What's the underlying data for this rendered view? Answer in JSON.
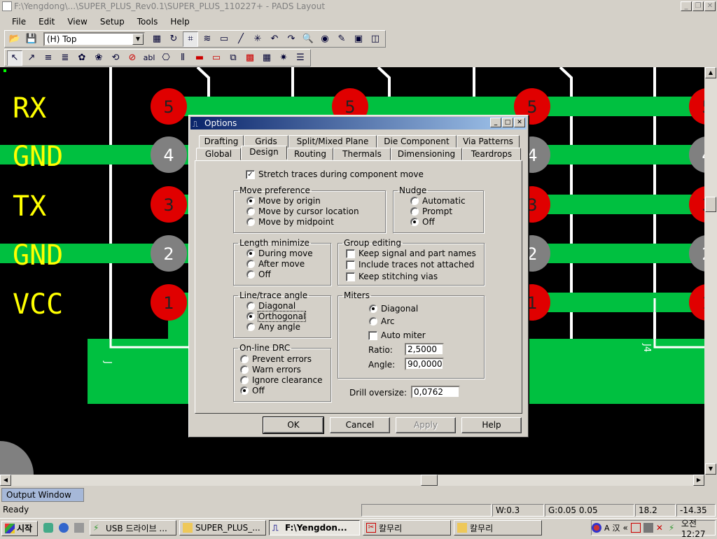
{
  "window": {
    "title": "F:\\Yengdong\\...\\SUPER_PLUS_Rev0.1\\SUPER_PLUS_110227+ - PADS Layout"
  },
  "menu": [
    "File",
    "Edit",
    "View",
    "Setup",
    "Tools",
    "Help"
  ],
  "toolbar": {
    "layer": "(H) Top"
  },
  "pcb": {
    "labels": [
      "RX",
      "GND",
      "TX",
      "GND",
      "VCC"
    ],
    "pins": [
      "5",
      "4",
      "3",
      "2",
      "1"
    ],
    "pin_colors": [
      "#e00000",
      "#808080",
      "#e00000",
      "#808080",
      "#e00000"
    ],
    "trace_color": "#00c040",
    "bg": "#000000"
  },
  "dialog": {
    "title": "Options",
    "tabs_row1": [
      "Drafting",
      "Grids",
      "Split/Mixed Plane",
      "Die Component",
      "Via Patterns"
    ],
    "tabs_row2": [
      "Global",
      "Design",
      "Routing",
      "Thermals",
      "Dimensioning",
      "Teardrops"
    ],
    "stretch_traces": "Stretch traces during component move",
    "move_preference": {
      "title": "Move preference",
      "options": [
        "Move by origin",
        "Move by cursor location",
        "Move by midpoint"
      ]
    },
    "nudge": {
      "title": "Nudge",
      "options": [
        "Automatic",
        "Prompt",
        "Off"
      ]
    },
    "length_minimize": {
      "title": "Length minimize",
      "options": [
        "During move",
        "After move",
        "Off"
      ]
    },
    "group_editing": {
      "title": "Group editing",
      "options": [
        "Keep signal and part names",
        "Include traces not attached",
        "Keep stitching vias"
      ]
    },
    "line_angle": {
      "title": "Line/trace angle",
      "options": [
        "Diagonal",
        "Orthogonal",
        "Any angle"
      ]
    },
    "miters": {
      "title": "Miters",
      "options": [
        "Diagonal",
        "Arc"
      ],
      "auto_miter": "Auto miter",
      "ratio_label": "Ratio:",
      "ratio": "2,5000",
      "angle_label": "Angle:",
      "angle": "90,0000"
    },
    "online_drc": {
      "title": "On-line DRC",
      "options": [
        "Prevent errors",
        "Warn errors",
        "Ignore clearance",
        "Off"
      ]
    },
    "drill_oversize_label": "Drill oversize:",
    "drill_oversize": "0,0762",
    "buttons": {
      "ok": "OK",
      "cancel": "Cancel",
      "apply": "Apply",
      "help": "Help"
    }
  },
  "output_window": "Output Window",
  "status": {
    "ready": "Ready",
    "w": "W:0.3",
    "g": "G:0.05 0.05",
    "x": "18.2",
    "y": "-14.35"
  },
  "taskbar": {
    "start": "시작",
    "tasks": [
      "USB 드라이브 ...",
      "SUPER_PLUS_...",
      "F:\\Yengdon...",
      "칼무리",
      "칼무리"
    ],
    "clock": "오전 12:27"
  }
}
